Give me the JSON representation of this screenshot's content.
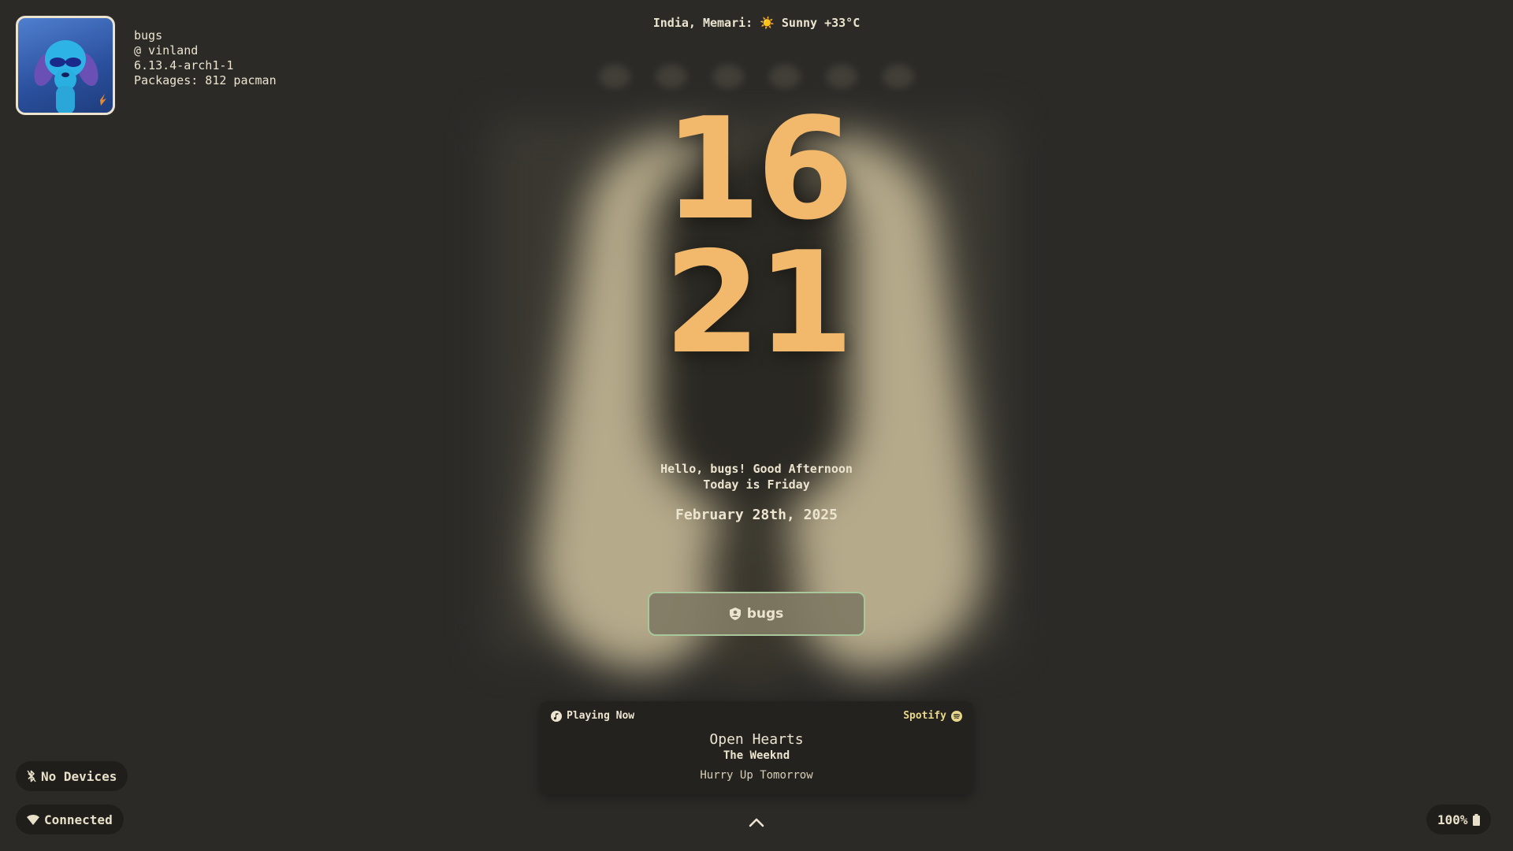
{
  "profile": {
    "username": "bugs",
    "host": "@ vinland",
    "kernel": "6.13.4-arch1-1",
    "packages": "Packages: 812 pacman",
    "avatar_icon": "dog-with-sunglasses-icon"
  },
  "weather": {
    "text": "India, Memari: ☀️   Sunny +33°C"
  },
  "clock": {
    "hours": "16",
    "minutes": "21"
  },
  "greeting": {
    "line1": "Hello, bugs! Good Afternoon",
    "line2": "Today is Friday",
    "date": "February 28th, 2025"
  },
  "login": {
    "user_label": "bugs",
    "icon": "user-shield-icon"
  },
  "media": {
    "status_label": "Playing Now",
    "source_label": "Spotify",
    "track_title": "Open Hearts",
    "artist": "The Weeknd",
    "album": "Hurry Up Tomorrow"
  },
  "status": {
    "bluetooth_label": "No Devices",
    "network_label": "Connected",
    "battery_label": "100%"
  },
  "colors": {
    "background": "#2b2a27",
    "clock": "#f2b86b",
    "text": "#ece4cf",
    "button_border": "#a8c79a",
    "spotify": "#e8d78a"
  }
}
